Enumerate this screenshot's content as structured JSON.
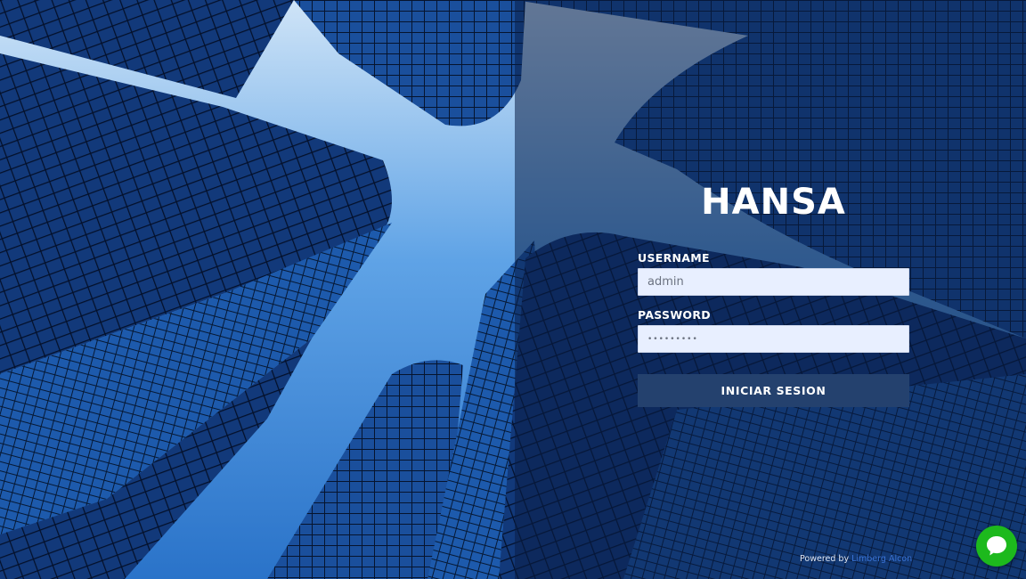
{
  "brand": {
    "title": "HANSA"
  },
  "form": {
    "username_label": "USERNAME",
    "username_value": "admin",
    "password_label": "PASSWORD",
    "password_value": "•••••••••",
    "submit_label": "INICIAR SESION"
  },
  "footer": {
    "powered_by": "Powered by",
    "author": "Limberg Alcon"
  },
  "icons": {
    "chat": "chat-bubble-icon"
  },
  "colors": {
    "button_bg": "#24416e",
    "input_bg": "#e8efff",
    "chat_bg": "#1db91d",
    "link": "#3b74d6"
  }
}
